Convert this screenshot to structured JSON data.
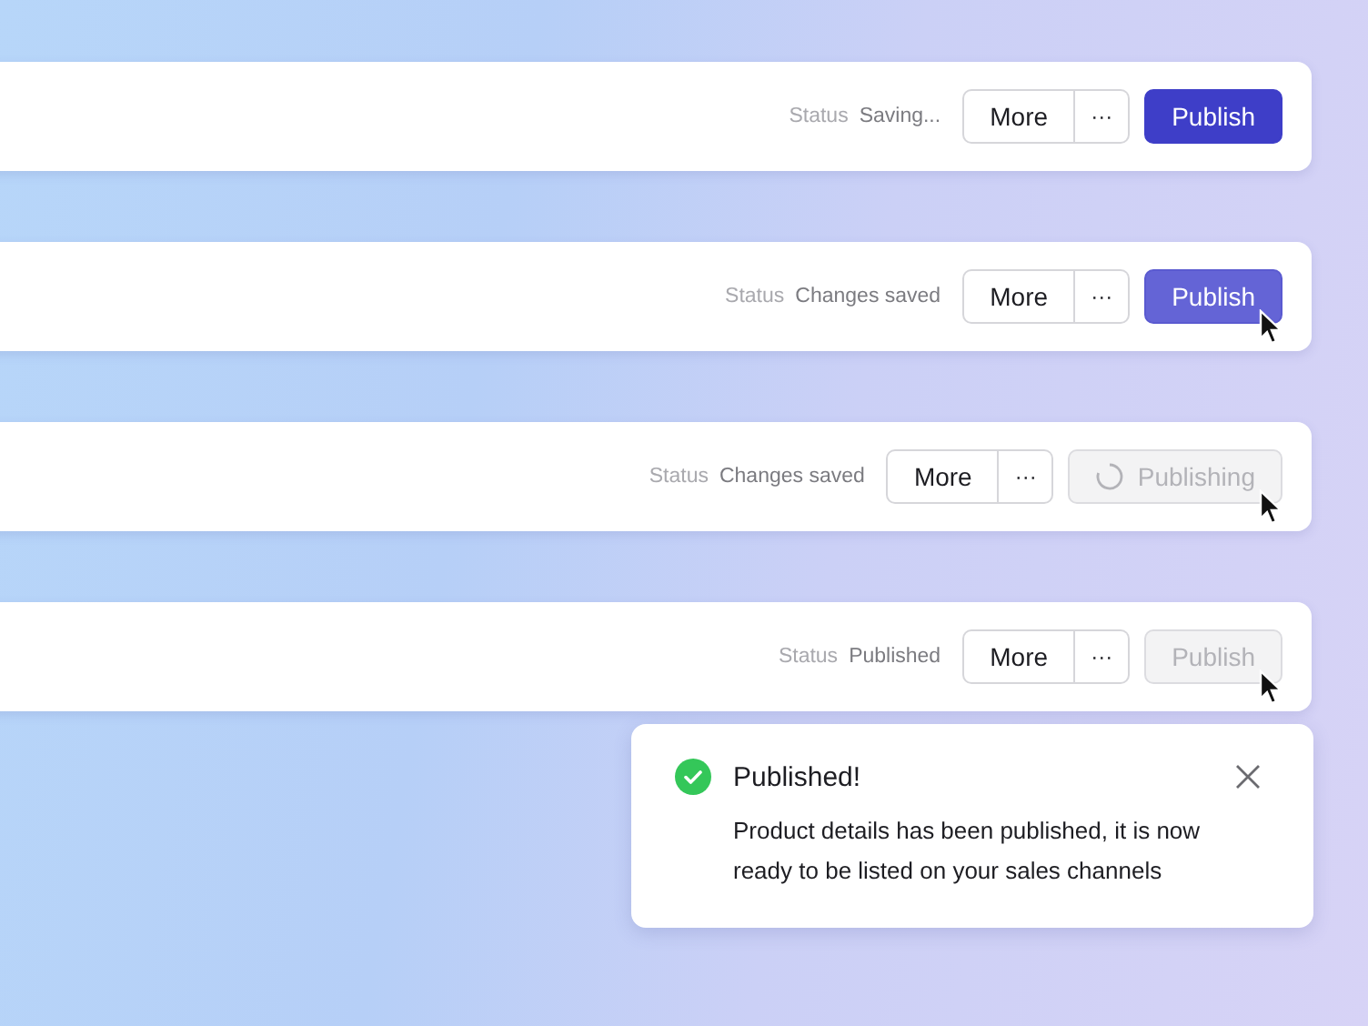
{
  "bars": [
    {
      "status_label": "Status",
      "status_value": "Saving...",
      "more": "More",
      "overflow": "···",
      "publish": {
        "label": "Publish",
        "kind": "default"
      },
      "cursor": false
    },
    {
      "status_label": "Status",
      "status_value": "Changes saved",
      "more": "More",
      "overflow": "···",
      "publish": {
        "label": "Publish",
        "kind": "hover"
      },
      "cursor": true
    },
    {
      "status_label": "Status",
      "status_value": "Changes saved",
      "more": "More",
      "overflow": "···",
      "publish": {
        "label": "Publishing",
        "kind": "loading"
      },
      "cursor": true
    },
    {
      "status_label": "Status",
      "status_value": "Published",
      "more": "More",
      "overflow": "···",
      "publish": {
        "label": "Publish",
        "kind": "disabled"
      },
      "cursor": true
    }
  ],
  "toast": {
    "title": "Published!",
    "message": "Product details has been published, it is now ready to be listed on your sales channels"
  }
}
